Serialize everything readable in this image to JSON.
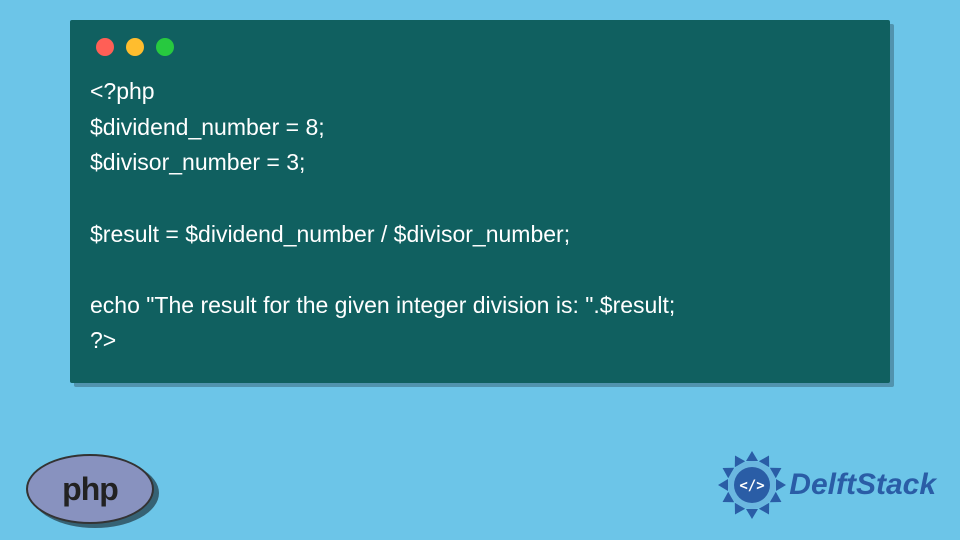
{
  "colors": {
    "page_bg": "#6cc5e8",
    "window_bg": "#106060",
    "code_text": "#ffffff",
    "dot_red": "#ff5f56",
    "dot_yellow": "#ffbd2e",
    "dot_green": "#27c93f",
    "php_bg": "#8892bf",
    "ds_main": "#2a5da6"
  },
  "code": {
    "line1": "<?php",
    "line2": "$dividend_number = 8;",
    "line3": "$divisor_number = 3;",
    "line4": "",
    "line5": "$result = $dividend_number / $divisor_number;",
    "line6": "",
    "line7": "echo \"The result for the given integer division is: \".$result;",
    "line8": "?>"
  },
  "logos": {
    "php_label": "php",
    "delftstack_label": "DelftStack"
  }
}
